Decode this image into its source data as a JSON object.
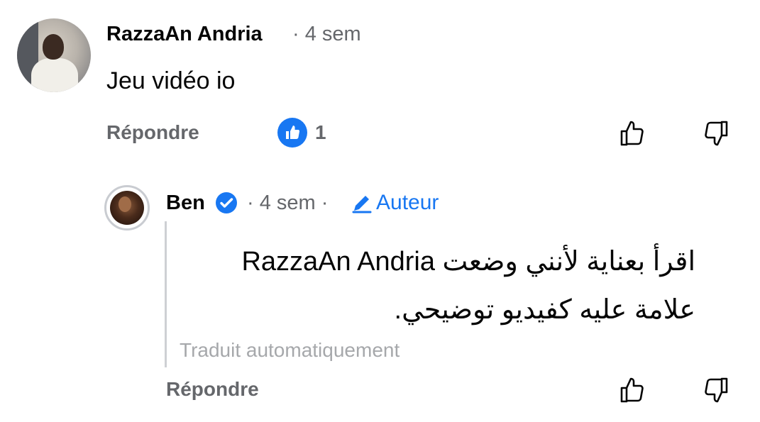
{
  "comment": {
    "author": "RazzaAn Andria",
    "time": "· 4 sem",
    "text": "Jeu vidéo io",
    "reply_label": "Répondre",
    "reaction_count": "1",
    "reaction_icon": "thumbs-up-icon",
    "like_icon": "thumbs-up-outline-icon",
    "dislike_icon": "thumbs-down-outline-icon"
  },
  "reply": {
    "author": "Ben",
    "verified_icon": "verified-badge-icon",
    "time": "· 4 sem ·",
    "author_tag": "Auteur",
    "author_tag_icon": "pencil-icon",
    "text": "اقرأ بعناية لأنني وضعت RazzaAn Andria علامة عليه كفيديو توضيحي.",
    "translated_label": "Traduit automatiquement",
    "reply_label": "Répondre"
  },
  "colors": {
    "accent": "#1877f2",
    "secondary_text": "#65676b",
    "muted_text": "#a6a8ab"
  }
}
